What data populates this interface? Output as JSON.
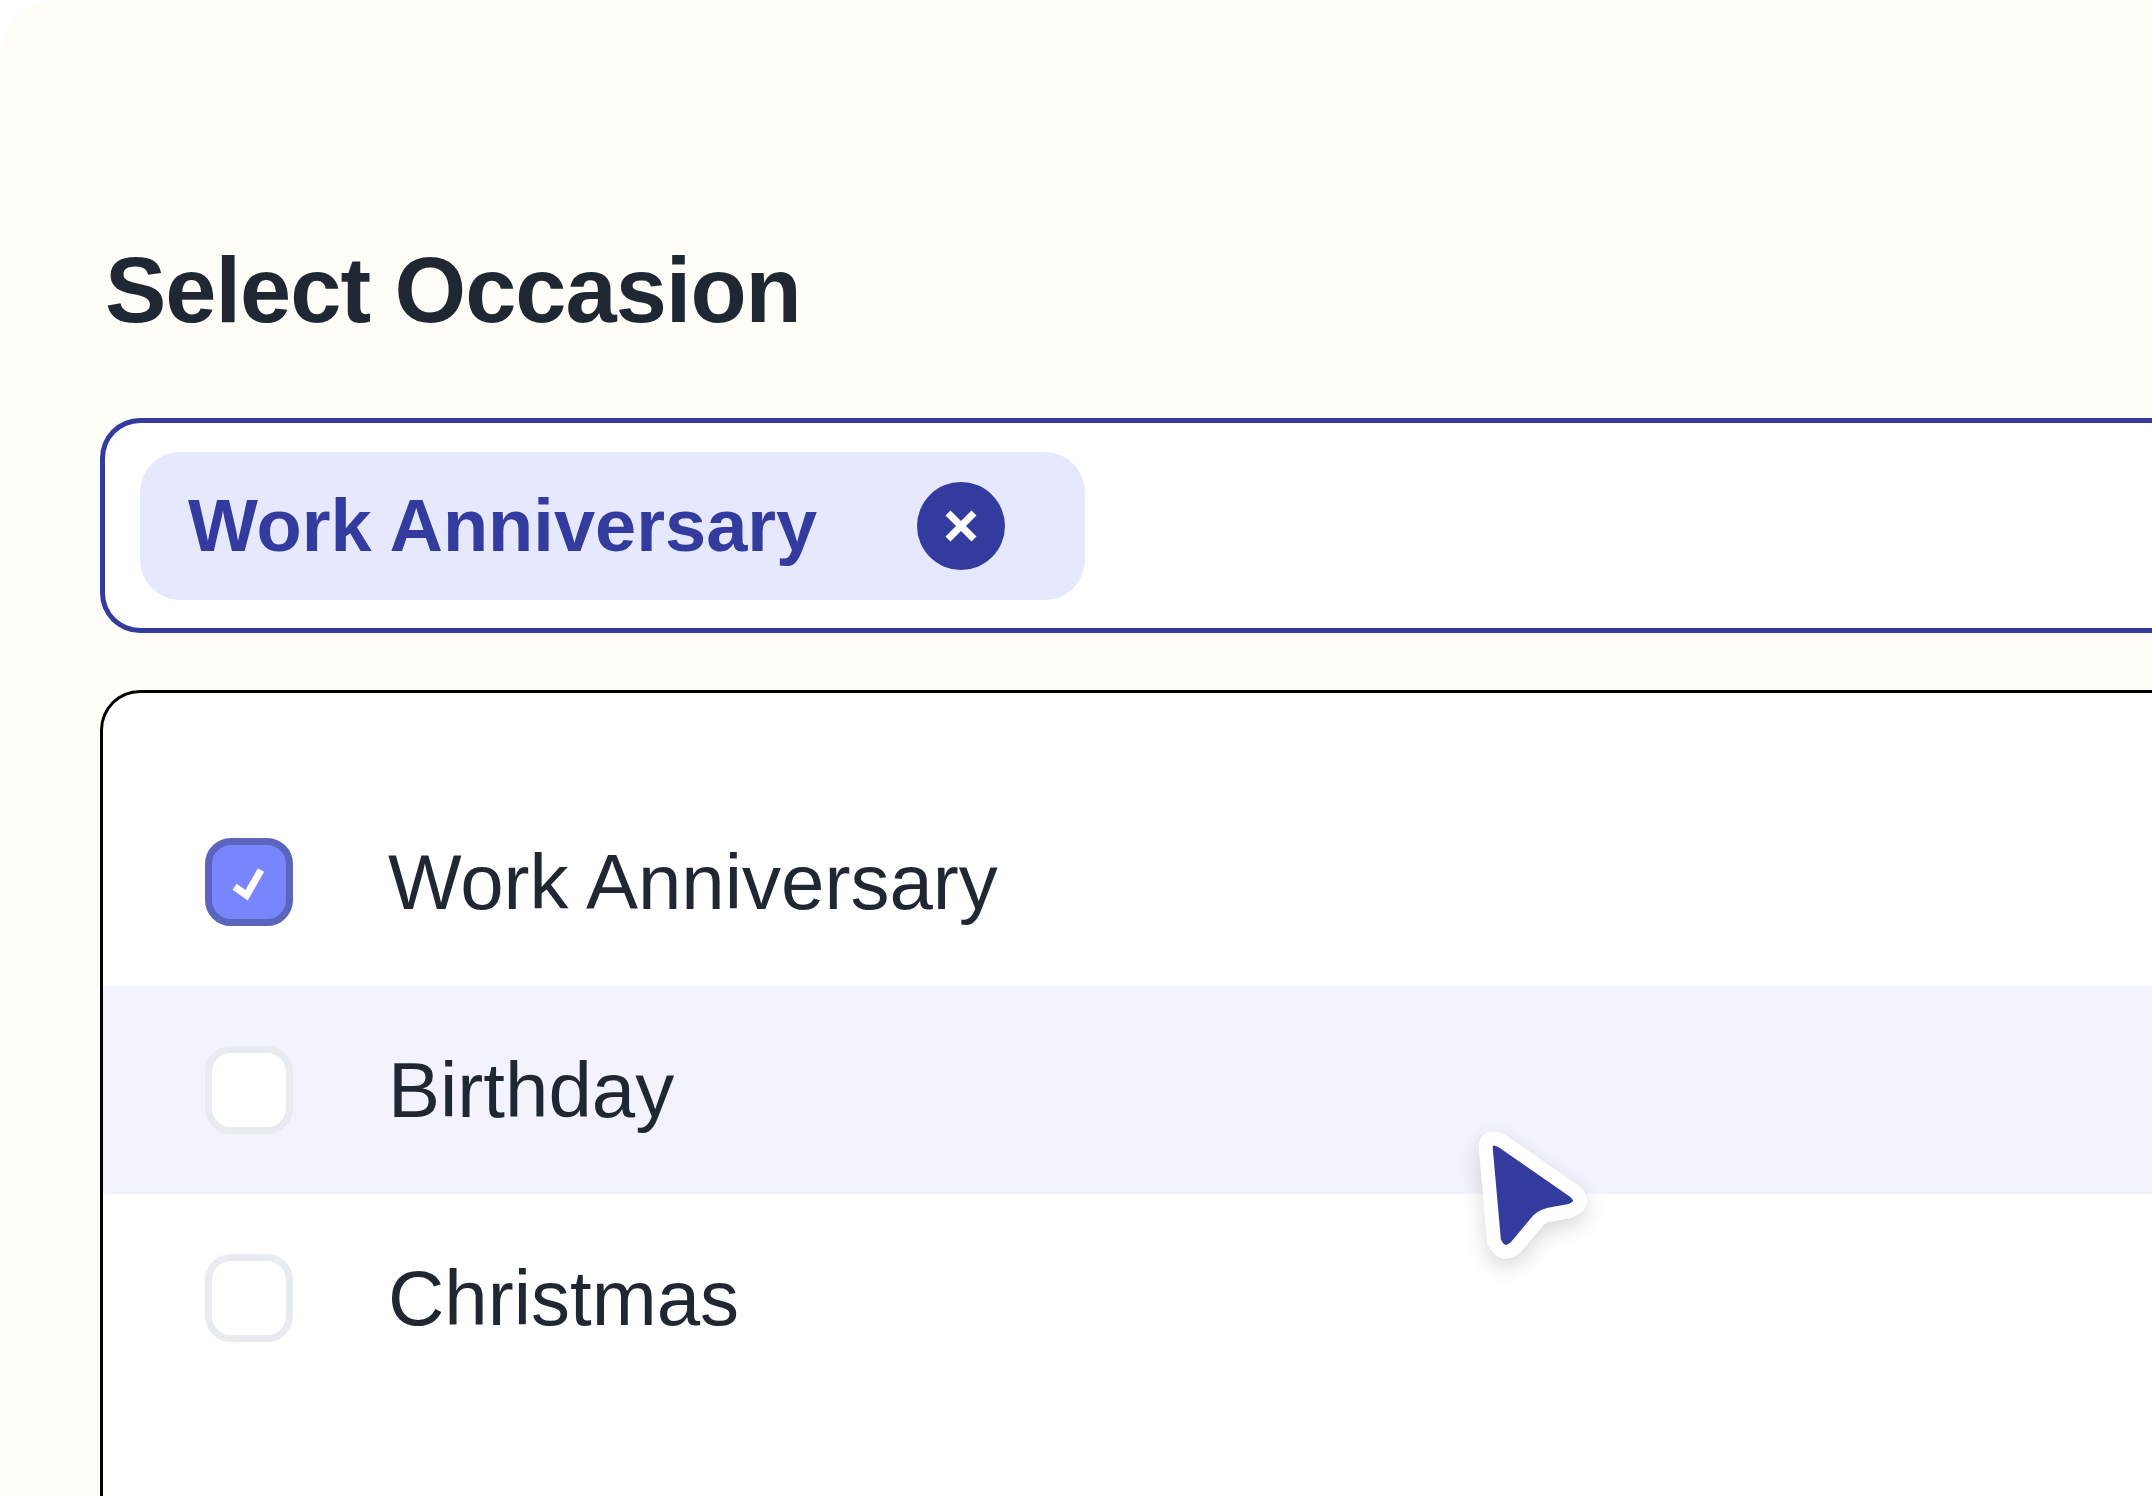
{
  "title": "Select Occasion",
  "field": {
    "chips": [
      {
        "label": "Work Anniversary"
      }
    ]
  },
  "options": [
    {
      "label": "Work Anniversary",
      "checked": true,
      "highlighted": false
    },
    {
      "label": "Birthday",
      "checked": false,
      "highlighted": true
    },
    {
      "label": "Christmas",
      "checked": false,
      "highlighted": false
    }
  ]
}
